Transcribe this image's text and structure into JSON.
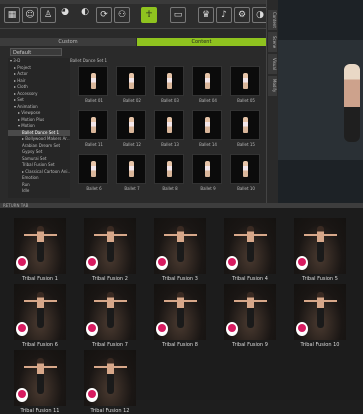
{
  "toolbar": {
    "icons": [
      "grid-icon",
      "figure-icon",
      "figure-outline-icon",
      "lips-icon",
      "mask-icon",
      "rotate-icon",
      "motion-icon",
      "pose-icon",
      "capture-icon",
      "animation-icon",
      "sound-icon",
      "settings-icon",
      "palette-icon"
    ],
    "extra_labels": [
      "F8",
      "Motion"
    ]
  },
  "tabs": {
    "custom": "Custom",
    "content": "Content"
  },
  "filter": {
    "value": "Default"
  },
  "tree": {
    "items": [
      {
        "label": "▾ 3-D",
        "indent": 0
      },
      {
        "label": "▸ Project",
        "indent": 1
      },
      {
        "label": "▸ Actor",
        "indent": 1
      },
      {
        "label": "▸ Hair",
        "indent": 1
      },
      {
        "label": "▸ Cloth",
        "indent": 1
      },
      {
        "label": "▸ Accessory",
        "indent": 1
      },
      {
        "label": "▸ Set",
        "indent": 1
      },
      {
        "label": "▾ Animation",
        "indent": 1
      },
      {
        "label": "▸ Viewpose",
        "indent": 2
      },
      {
        "label": "▸ Motion Plus",
        "indent": 2
      },
      {
        "label": "▾ Motion",
        "indent": 2
      },
      {
        "label": "Ballet Dance Set 1",
        "indent": 3,
        "selected": true
      },
      {
        "label": "▸ Bollywood Makers Ar…",
        "indent": 3
      },
      {
        "label": "Arabian Dream Set",
        "indent": 3
      },
      {
        "label": "Gypsy Set",
        "indent": 3
      },
      {
        "label": "Samurai Set",
        "indent": 3
      },
      {
        "label": "Tribal Fusion Set",
        "indent": 3
      },
      {
        "label": "▸ Classical Cartoon Ani…",
        "indent": 3
      },
      {
        "label": "Emotion",
        "indent": 3
      },
      {
        "label": "Run",
        "indent": 3
      },
      {
        "label": "Idle",
        "indent": 3
      }
    ]
  },
  "main_header": "Ballet Dance Set 1",
  "top_grid": [
    {
      "label": "Ballet 01"
    },
    {
      "label": "Ballet 02"
    },
    {
      "label": "Ballet 03"
    },
    {
      "label": "Ballet 04"
    },
    {
      "label": "Ballet 05"
    },
    {
      "label": "Ballet 11"
    },
    {
      "label": "Ballet 12"
    },
    {
      "label": "Ballet 13"
    },
    {
      "label": "Ballet 14"
    },
    {
      "label": "Ballet 15"
    },
    {
      "label": "Ballet 6"
    },
    {
      "label": "Ballet 7"
    },
    {
      "label": "Ballet 8"
    },
    {
      "label": "Ballet 9"
    },
    {
      "label": "Ballet 10"
    }
  ],
  "right_tabs": [
    "Content",
    "Scene",
    "Visual",
    "Modify"
  ],
  "divider_label": "RETURN TAB",
  "bottom_grid": [
    {
      "label": "Tribal Fusion 1"
    },
    {
      "label": "Tribal Fusion 2"
    },
    {
      "label": "Tribal Fusion 3"
    },
    {
      "label": "Tribal Fusion 4"
    },
    {
      "label": "Tribal Fusion 5"
    },
    {
      "label": "Tribal Fusion 6"
    },
    {
      "label": "Tribal Fusion 7"
    },
    {
      "label": "Tribal Fusion 8"
    },
    {
      "label": "Tribal Fusion 9"
    },
    {
      "label": "Tribal Fusion 10"
    },
    {
      "label": "Tribal Fusion 11"
    },
    {
      "label": "Tribal Fusion 12"
    }
  ],
  "colors": {
    "accent": "#8fc31f",
    "panel": "#2a2a2a",
    "background": "#1c1c1c"
  }
}
